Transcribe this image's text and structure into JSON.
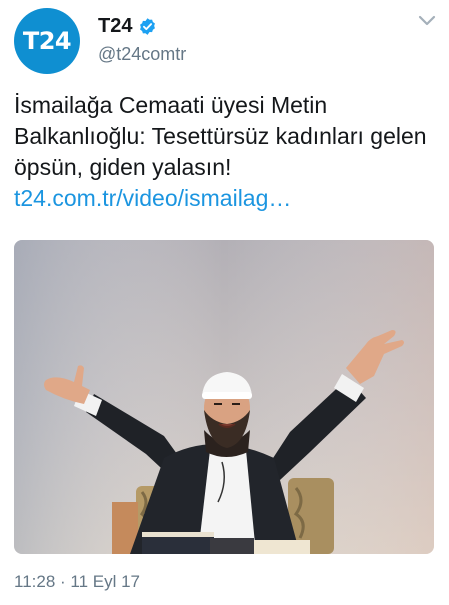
{
  "account": {
    "avatar_text": "T24",
    "display_name": "T24",
    "handle": "@t24comtr",
    "verified": true
  },
  "tweet": {
    "text": "İsmailağa Cemaati üyesi Metin Balkanlıoğlu: Tesettürsüz kadınları gelen öpsün, giden yalasın!",
    "link": "t24.com.tr/video/ismailag…",
    "timestamp": "11:28 · 11 Eyl 17"
  },
  "icons": {
    "verified": "verified-badge-icon",
    "menu": "chevron-down-icon"
  },
  "colors": {
    "brand_blue": "#1b95e0",
    "avatar_blue": "#0f8fd1",
    "text": "#14171a",
    "muted": "#657786"
  }
}
